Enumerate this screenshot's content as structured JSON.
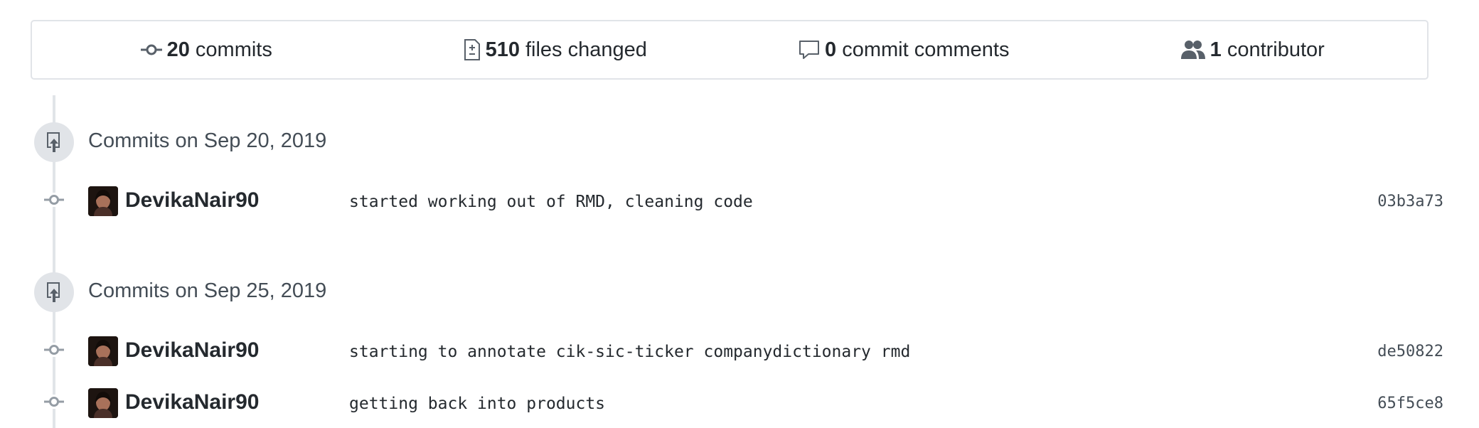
{
  "summary": {
    "commits": {
      "count": "20",
      "label": "commits",
      "icon": "git-commit-icon"
    },
    "files": {
      "count": "510",
      "label": "files changed",
      "icon": "file-diff-icon"
    },
    "comments": {
      "count": "0",
      "label": "commit comments",
      "icon": "comment-icon"
    },
    "contributors": {
      "count": "1",
      "label": "contributor",
      "icon": "people-icon"
    }
  },
  "days": [
    {
      "title": "Commits on Sep 20, 2019",
      "commits": [
        {
          "author": "DevikaNair90",
          "message": "started working out of RMD, cleaning code",
          "sha": "03b3a73"
        }
      ]
    },
    {
      "title": "Commits on Sep 25, 2019",
      "commits": [
        {
          "author": "DevikaNair90",
          "message": "starting to annotate cik-sic-ticker companydictionary rmd",
          "sha": "de50822"
        },
        {
          "author": "DevikaNair90",
          "message": "getting back into products",
          "sha": "65f5ce8"
        }
      ]
    }
  ],
  "colors": {
    "border": "#e1e4e8",
    "icon": "#586069",
    "text": "#24292e",
    "muted": "#444d56"
  }
}
